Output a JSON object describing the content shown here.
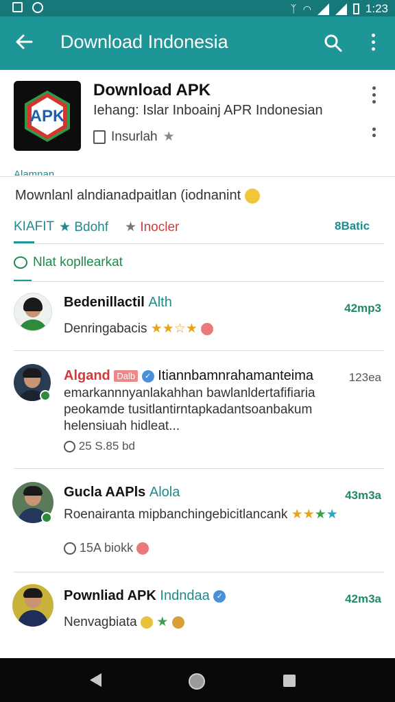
{
  "status": {
    "time": "1:23"
  },
  "appbar": {
    "title": "Download Indonesia"
  },
  "app": {
    "logo_text": "APK",
    "name": "Download APK",
    "subtitle": "Iehang: Islar Inboainj APR Indonesian",
    "meta": "Insurlah"
  },
  "partial_text": "Alamnan",
  "description": "Mownlanl alndianadpaitlan (iodnanint",
  "tabs": {
    "first": "KIAFIT",
    "second": "Bdohf",
    "third": "Inocler",
    "right": "8Batic"
  },
  "filter": {
    "label": "Nlat kopllearkat"
  },
  "items": [
    {
      "name": "Bedenillactil",
      "tag": "Alth",
      "time": "42mp3",
      "line1": "Denringabacis"
    },
    {
      "name": "Algand",
      "badge": "Dalb",
      "rest": "Itiannbamnrahamanteima",
      "time": "123ea",
      "line1": "emarkannnyanlakahhan bawlanldertafifiaria",
      "line2": "peokamde tusitlantirntapkadantsoanbakum",
      "line3": "helensiuah hidleat...",
      "meta": "25 S.85 bd"
    },
    {
      "name": "Gucla AAPls",
      "tag": "Alola",
      "time": "43m3a",
      "line1": "Roenairanta mipbanchingebicitlancank",
      "meta": "15A biokk"
    },
    {
      "name": "Pownliad APK",
      "tag": "Indndaa",
      "time": "42m3a",
      "line1": "Nenvagbiata"
    }
  ],
  "colors": {
    "status_bar": "#17787a",
    "app_bar": "#1e9597",
    "accent": "#1e8a8c",
    "nav": "#080808"
  }
}
